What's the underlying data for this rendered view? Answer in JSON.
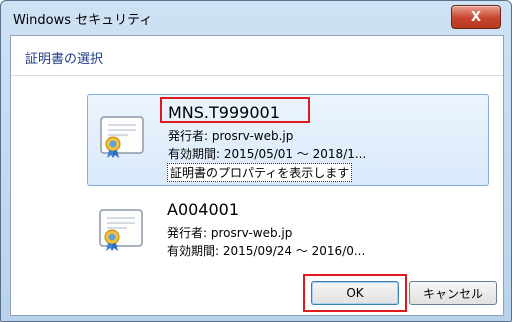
{
  "window": {
    "title": "Windows セキュリティ",
    "close_label": "X"
  },
  "section": {
    "title": "証明書の選択"
  },
  "certificates": [
    {
      "name": "MNS.T999001",
      "issuer": "発行者: prosrv-web.jp",
      "validity": "有効期間: 2015/05/01 ～ 2018/1...",
      "link": "証明書のプロパティを表示します",
      "icon": "certificate-icon",
      "selected": true
    },
    {
      "name": "A004001",
      "issuer": "発行者: prosrv-web.jp",
      "validity": "有効期間: 2015/09/24 ～ 2016/0...",
      "icon": "certificate-icon",
      "selected": false
    }
  ],
  "buttons": {
    "ok": "OK",
    "cancel": "キャンセル"
  },
  "colors": {
    "highlight": "#e0191e",
    "selection": "#d9e9fb",
    "title_text": "#1f3c88"
  }
}
